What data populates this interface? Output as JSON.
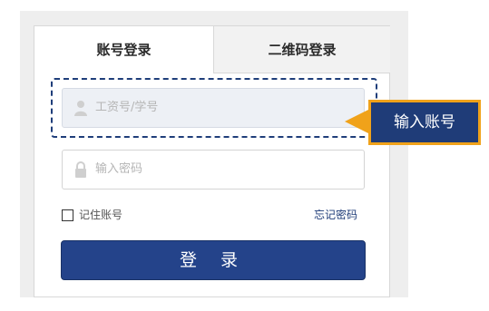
{
  "tabs": [
    {
      "label": "账号登录",
      "active": true
    },
    {
      "label": "二维码登录",
      "active": false
    }
  ],
  "fields": {
    "username": {
      "placeholder": "工资号/学号",
      "value": "",
      "icon": "user-icon"
    },
    "password": {
      "placeholder": "输入密码",
      "value": "",
      "icon": "lock-icon"
    }
  },
  "callout": {
    "label": "输入账号"
  },
  "remember": {
    "label": "记住账号",
    "checked": false
  },
  "forgot": {
    "label": "忘记密码"
  },
  "login_button": {
    "label": "登 录"
  },
  "colors": {
    "accent": "#24438a",
    "callout_border": "#f0a21a",
    "callout_fill": "#1f3c78",
    "dashed_outline": "#1f3e7a"
  }
}
